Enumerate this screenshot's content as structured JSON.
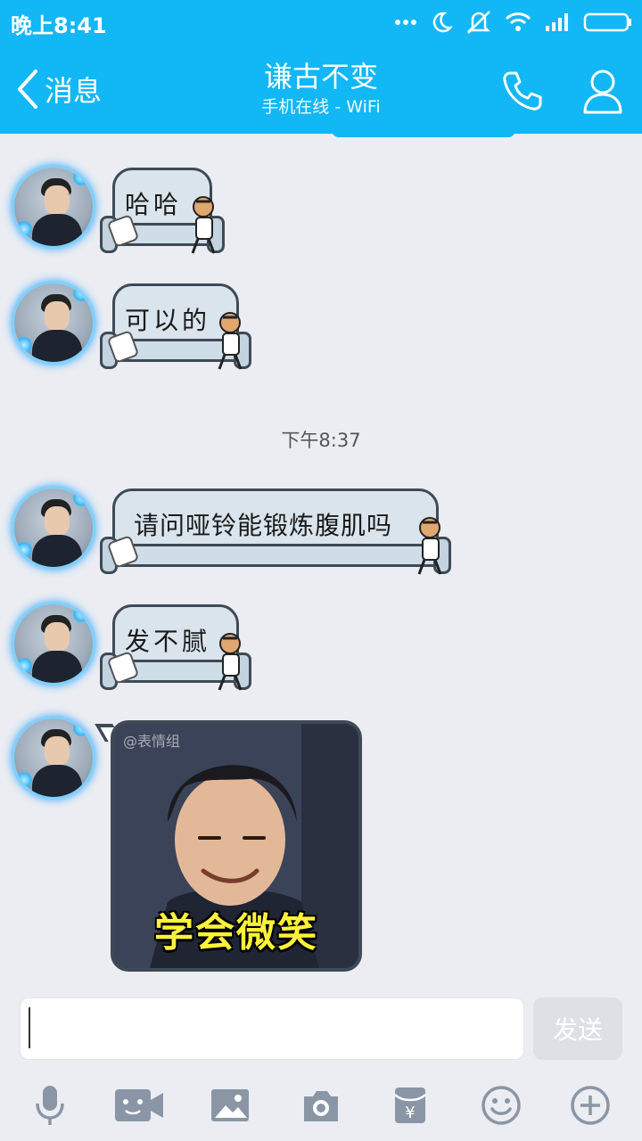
{
  "status_bar": {
    "time": "晚上8:41"
  },
  "header": {
    "back_label": "消息",
    "title": "谦古不变",
    "subtitle": "手机在线 - WiFi"
  },
  "messages": [
    {
      "type": "sticker_text",
      "text": "哈哈"
    },
    {
      "type": "sticker_text",
      "text": "可以的"
    },
    {
      "type": "sticker_text",
      "text": "请问哑铃能锻炼腹肌吗"
    },
    {
      "type": "sticker_text",
      "text": "发不腻"
    },
    {
      "type": "image",
      "caption": "学会微笑",
      "watermark": "@表情组"
    }
  ],
  "time_divider": "下午8:37",
  "input": {
    "send_label": "发送"
  },
  "toolbar": {
    "icons": [
      "microphone-icon",
      "video-icon",
      "image-icon",
      "camera-icon",
      "red-packet-icon",
      "emoji-icon",
      "plus-icon"
    ]
  },
  "colors": {
    "brand": "#12b7f5",
    "background": "#ebedf2"
  }
}
